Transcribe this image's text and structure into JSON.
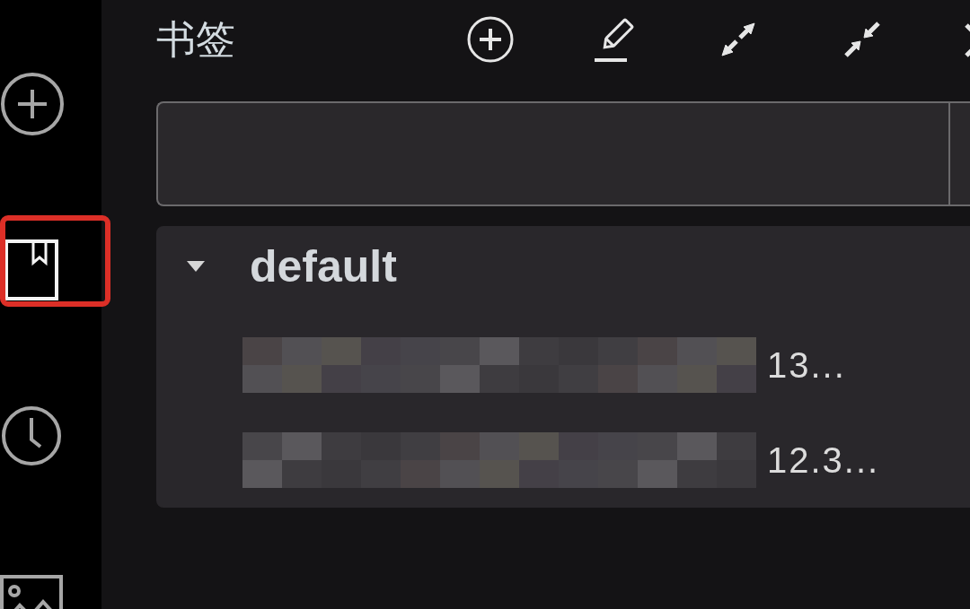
{
  "sidebar": {
    "items": [
      {
        "kind": "add",
        "selected": false,
        "highlighted": false
      },
      {
        "kind": "bookmarks",
        "selected": true,
        "highlighted": true
      },
      {
        "kind": "history",
        "selected": false,
        "highlighted": false
      },
      {
        "kind": "images",
        "selected": false,
        "highlighted": false
      }
    ]
  },
  "panel": {
    "title": "书签",
    "toolbar": [
      {
        "kind": "add"
      },
      {
        "kind": "edit"
      },
      {
        "kind": "expand"
      },
      {
        "kind": "collapse"
      },
      {
        "kind": "partial"
      }
    ]
  },
  "groups": [
    {
      "name": "default",
      "expanded": true,
      "bookmarks": [
        {
          "text": "13...",
          "redacted": true
        },
        {
          "text": "12.3...",
          "redacted": true
        }
      ]
    }
  ]
}
